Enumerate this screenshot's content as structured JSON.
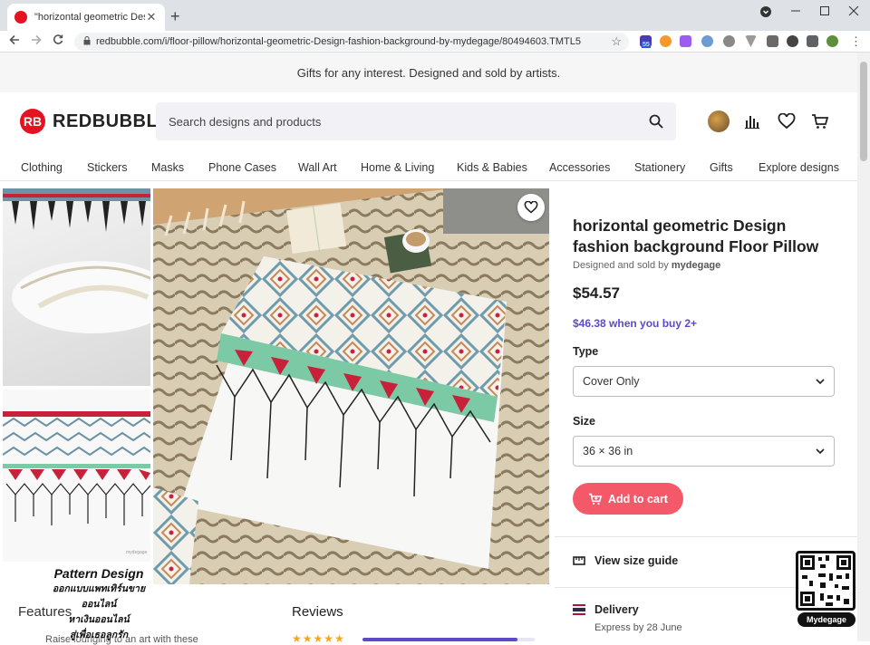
{
  "browser": {
    "tab_title": "\"horizontal geometric Design fas",
    "tab_close": "✕",
    "new_tab": "+",
    "url": "redbubble.com/i/floor-pillow/horizontal-geometric-Design-fashion-background-by-mydegage/80494603.TMTL5",
    "ext_badge": "55"
  },
  "banner": {
    "text": "Gifts for any interest. Designed and sold by artists."
  },
  "header": {
    "logo_word": "REDBUBBLE",
    "logo_mark": "RB",
    "search_placeholder": "Search designs and products"
  },
  "nav": {
    "items": [
      "Clothing",
      "Stickers",
      "Masks",
      "Phone Cases",
      "Wall Art",
      "Home & Living",
      "Kids & Babies",
      "Accessories",
      "Stationery",
      "Gifts",
      "Explore designs"
    ]
  },
  "product": {
    "title": "horizontal geometric Design fashion background Floor Pillow",
    "seller_prefix": "Designed and sold by",
    "seller_name": "mydegage",
    "price": "$54.57",
    "bulk_price": "$46.38 when you buy 2+",
    "type_label": "Type",
    "type_value": "Cover Only",
    "size_label": "Size",
    "size_value": "36 × 36 in",
    "cart_label": "Add to cart",
    "size_guide": "View size guide",
    "delivery_label": "Delivery",
    "delivery_date": "Express by 28 June"
  },
  "lower": {
    "features": "Features",
    "features_text": "Raise lounging to an art with these",
    "reviews": "Reviews",
    "stars": "★★★★★"
  },
  "overlay": {
    "watermark_title": "Pattern Design",
    "watermark_lines": [
      "ออกแบบแพทเทิร์นขายออนไลน์",
      "หาเงินออนไลน์",
      "สู่เพื่อเธอลูกรัก"
    ],
    "qr_label": "Mydegage",
    "thumb_caption": "mydegage"
  },
  "colors": {
    "brand_red": "#e41321",
    "cart_pink": "#f35968",
    "accent_purple": "#5c4ac7"
  }
}
